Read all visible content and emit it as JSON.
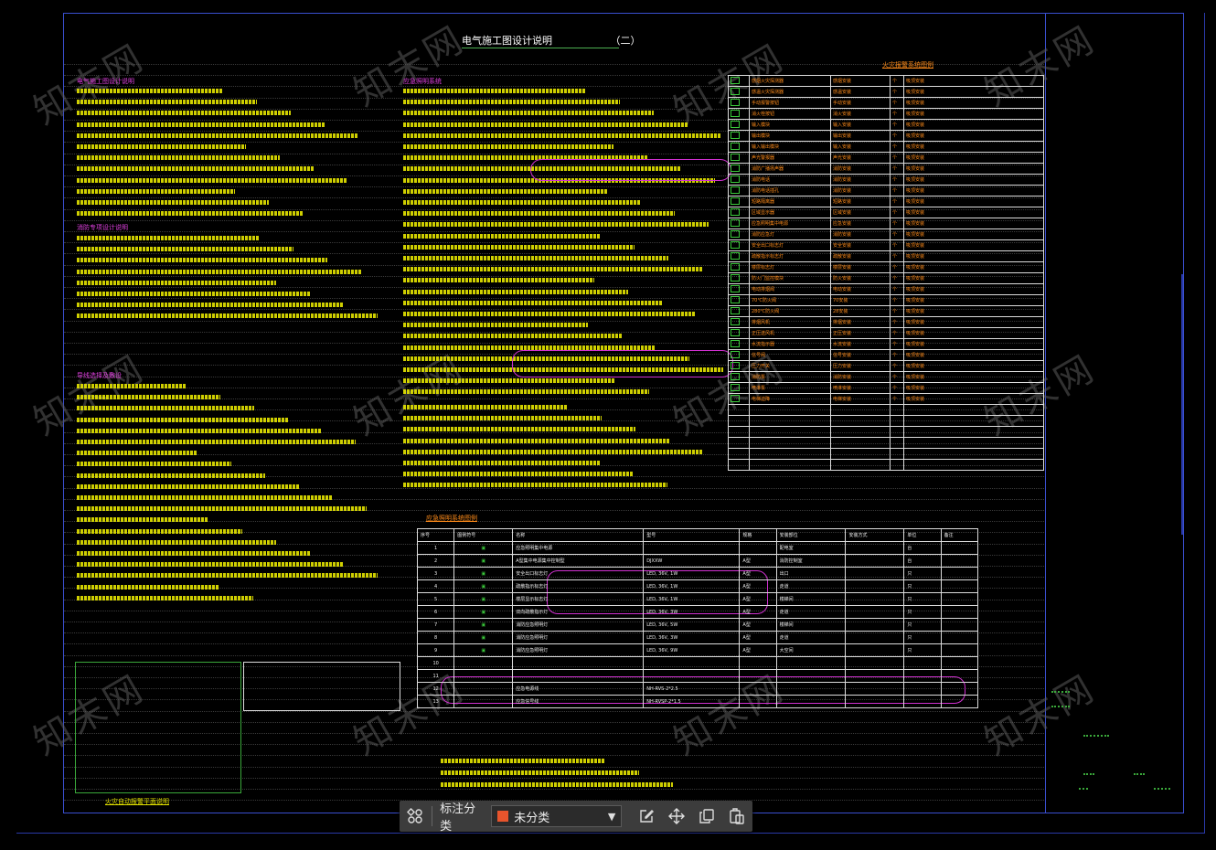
{
  "drawing": {
    "title": "电气施工图设计说明",
    "title_suffix": "（二）",
    "watermark": "知末网",
    "section_headers": {
      "left_top": "电气施工图设计说明",
      "left_mid": "消防专项设计说明",
      "left_low": "导线选择及敷设",
      "middle_top": "应急照明系统",
      "right_table": "火灾报警系统图例",
      "eq_table": "应急照明系统图例",
      "bottom_left": "火灾自动报警平面说明"
    },
    "legend_rows": [
      "感烟火灾探测器",
      "感温火灾探测器",
      "手动报警按钮",
      "消火栓按钮",
      "输入模块",
      "输出模块",
      "输入输出模块",
      "声光警报器",
      "消防广播扬声器",
      "消防电话",
      "消防电话插孔",
      "短路隔离器",
      "区域显示器",
      "应急照明集中电源",
      "消防应急灯",
      "安全出口标志灯",
      "疏散指示标志灯",
      "楼层标志灯",
      "防火门监控模块",
      "电动排烟阀",
      "70℃防火阀",
      "280℃防火阀",
      "排烟风机",
      "正压送风机",
      "水流指示器",
      "信号阀",
      "压力开关",
      "消防泵",
      "喷淋泵",
      "电梯迫降",
      "非消防电源切除",
      "防火卷帘门控制箱",
      "消防控制室",
      "接线箱",
      "信号线",
      "电源线"
    ],
    "eq_rows": [
      {
        "no": "1",
        "name": "应急照明集中电源",
        "model": "",
        "qty": "",
        "place": "配电室",
        "note": "台"
      },
      {
        "no": "2",
        "name": "A型集中电源集中控制型",
        "model": "DJXXW",
        "qty": "A型",
        "place": "消防控制室",
        "note": "台"
      },
      {
        "no": "3",
        "name": "安全出口标志灯",
        "model": "LED, 36V, 1W",
        "qty": "A型",
        "place": "出口",
        "note": "只"
      },
      {
        "no": "4",
        "name": "疏散指示标志灯",
        "model": "LED, 36V, 1W",
        "qty": "A型",
        "place": "走道",
        "note": "只"
      },
      {
        "no": "5",
        "name": "楼层显示标志灯",
        "model": "LED, 36V, 1W",
        "qty": "A型",
        "place": "楼梯间",
        "note": "只"
      },
      {
        "no": "6",
        "name": "双向疏散指示灯",
        "model": "LED, 36V, 3W",
        "qty": "A型",
        "place": "走道",
        "note": "只"
      },
      {
        "no": "7",
        "name": "消防应急照明灯",
        "model": "LED, 36V, 5W",
        "qty": "A型",
        "place": "楼梯间",
        "note": "只"
      },
      {
        "no": "8",
        "name": "消防应急照明灯",
        "model": "LED, 36V, 3W",
        "qty": "A型",
        "place": "走道",
        "note": "只"
      },
      {
        "no": "9",
        "name": "消防应急照明灯",
        "model": "LED, 36V, 9W",
        "qty": "A型",
        "place": "大空间",
        "note": "只"
      },
      {
        "no": "10",
        "name": "",
        "model": "",
        "qty": "",
        "place": "",
        "note": ""
      },
      {
        "no": "11",
        "name": "",
        "model": "",
        "qty": "",
        "place": "",
        "note": ""
      },
      {
        "no": "12",
        "name": "应急电源线",
        "model": "NH-RVS-2*2.5",
        "qty": "",
        "place": "",
        "note": ""
      },
      {
        "no": "13",
        "name": "应急信号线",
        "model": "NH-RVSP-2*1.5",
        "qty": "",
        "place": "",
        "note": ""
      }
    ]
  },
  "toolbar": {
    "label": "标注分类",
    "category_value": "未分类",
    "category_color": "#e8542c",
    "icons": [
      "grid-icon",
      "edit-icon",
      "move-icon",
      "copy-icon",
      "paste-icon"
    ]
  }
}
